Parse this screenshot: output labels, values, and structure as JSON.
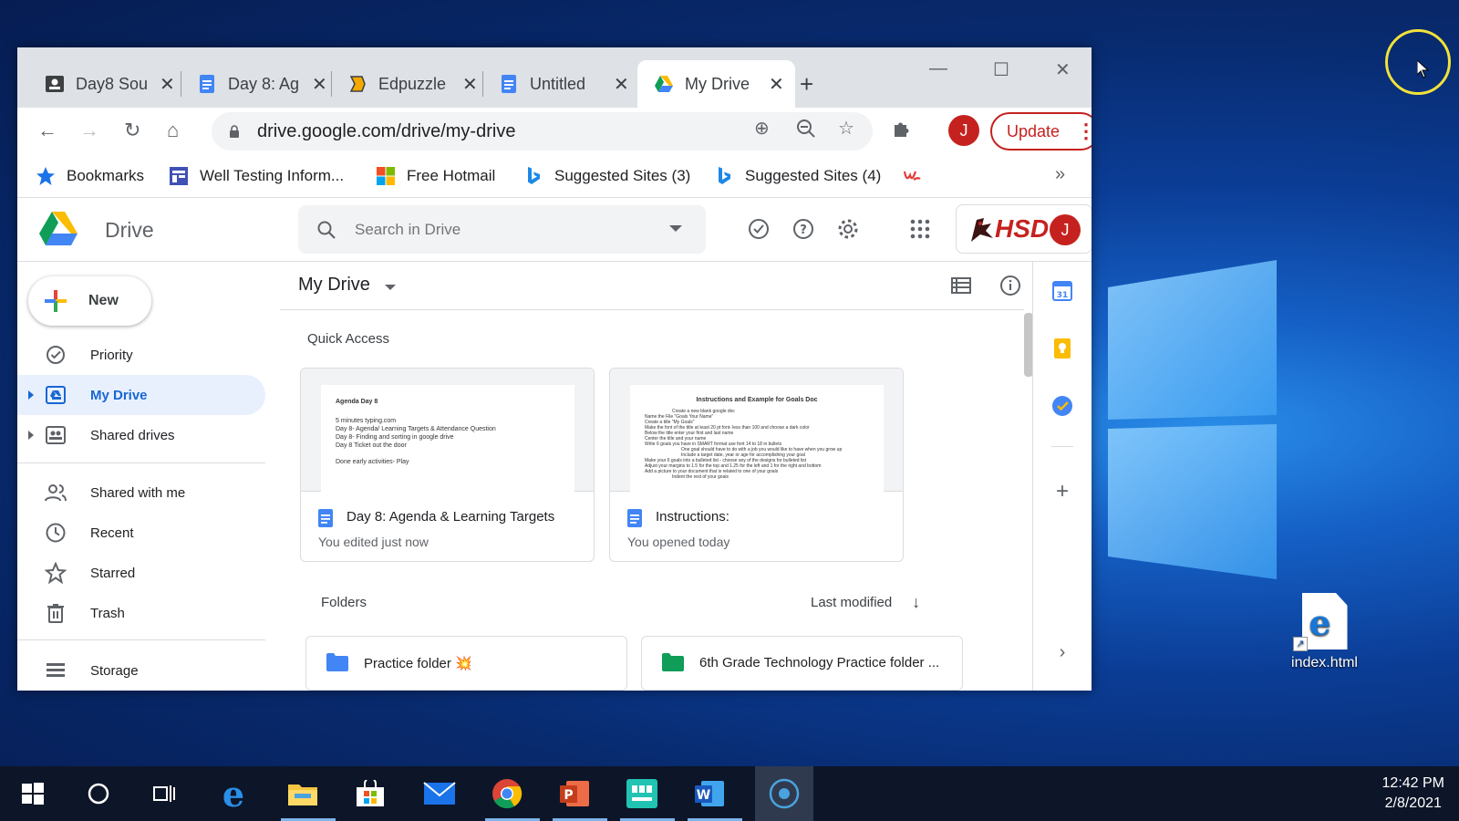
{
  "browser": {
    "tabs": [
      {
        "label": "Day8 Sou",
        "icon": "classroom-icon",
        "active": false
      },
      {
        "label": "Day 8: Ag",
        "icon": "docs-icon",
        "active": false
      },
      {
        "label": "Edpuzzle",
        "icon": "edpuzzle-icon",
        "active": false
      },
      {
        "label": "Untitled",
        "icon": "docs-icon",
        "active": false
      },
      {
        "label": "My Drive",
        "icon": "drive-icon",
        "active": true
      }
    ],
    "url": "drive.google.com/drive/my-drive",
    "profile_initial": "J",
    "update_label": "Update",
    "bookmarks": [
      {
        "label": "Bookmarks",
        "icon": "star-icon"
      },
      {
        "label": "Well Testing Inform...",
        "icon": "forms-icon"
      },
      {
        "label": "Free Hotmail",
        "icon": "microsoft-icon"
      },
      {
        "label": "Suggested Sites (3)",
        "icon": "bing-icon"
      },
      {
        "label": "Suggested Sites (4)",
        "icon": "bing-icon"
      }
    ],
    "bookmarks_overflow": "»"
  },
  "drive": {
    "title": "Drive",
    "search_placeholder": "Search in Drive",
    "org_logo": "HSD",
    "avatar_initial": "J",
    "new_label": "New",
    "nav": [
      {
        "label": "Priority",
        "icon": "priority-icon"
      },
      {
        "label": "My Drive",
        "icon": "my-drive-icon",
        "active": true
      },
      {
        "label": "Shared drives",
        "icon": "shared-drives-icon"
      },
      {
        "label": "Shared with me",
        "icon": "shared-with-me-icon"
      },
      {
        "label": "Recent",
        "icon": "clock-icon"
      },
      {
        "label": "Starred",
        "icon": "star-outline-icon"
      },
      {
        "label": "Trash",
        "icon": "trash-icon"
      },
      {
        "label": "Storage",
        "icon": "storage-icon"
      }
    ],
    "main_title": "My Drive",
    "quick_access_label": "Quick Access",
    "quick_access": [
      {
        "title": "Day 8: Agenda & Learning Targets",
        "subtitle": "You edited just now",
        "preview_title": "Agenda Day 8",
        "preview_lines": [
          "5 minutes typing.com",
          "Day 8- Agenda/ Learning Targets & Attendance Question",
          "Day 8- Finding and sorting in google drive",
          "Day 8 Ticket out the door",
          "",
          "Done early activities- Play"
        ]
      },
      {
        "title": "Instructions:",
        "subtitle": "You opened today",
        "preview_title": "Instructions and Example for Goals Doc",
        "preview_lines": [
          "Create a new blank google doc",
          "Name the File \"Goals Your Name\"",
          "Create a title \"My Goals\"",
          "Make the font of the title at least 20 pt font- less than 100 and choose a dark color",
          "Below the title enter your first and last name",
          "Center the title and your name",
          "Write 6 goals you have in SMART format use font 14 to 18 in bullets",
          "One goal should have to do with a job you would like to have when you grow up",
          "Include a target date, year or age for accomplishing your goal",
          "Make your 6 goals into a bulleted list - choose any of the designs for bulleted list",
          "Adjust your margins to 1.5 for the top and 1.25 for the left and 1 for the right and bottom",
          "Add a picture to your document that is related to one of your goals",
          "Indent the rest of your goals"
        ]
      }
    ],
    "folders_label": "Folders",
    "sort_label": "Last modified",
    "folders": [
      {
        "label": "Practice folder 💥",
        "color": "#4285f4"
      },
      {
        "label": "6th Grade Technology Practice folder ...",
        "color": "#0f9d58"
      }
    ]
  },
  "desktop": {
    "icon_label": "index.html"
  },
  "taskbar": {
    "time": "12:42 PM",
    "date": "2/8/2021"
  }
}
